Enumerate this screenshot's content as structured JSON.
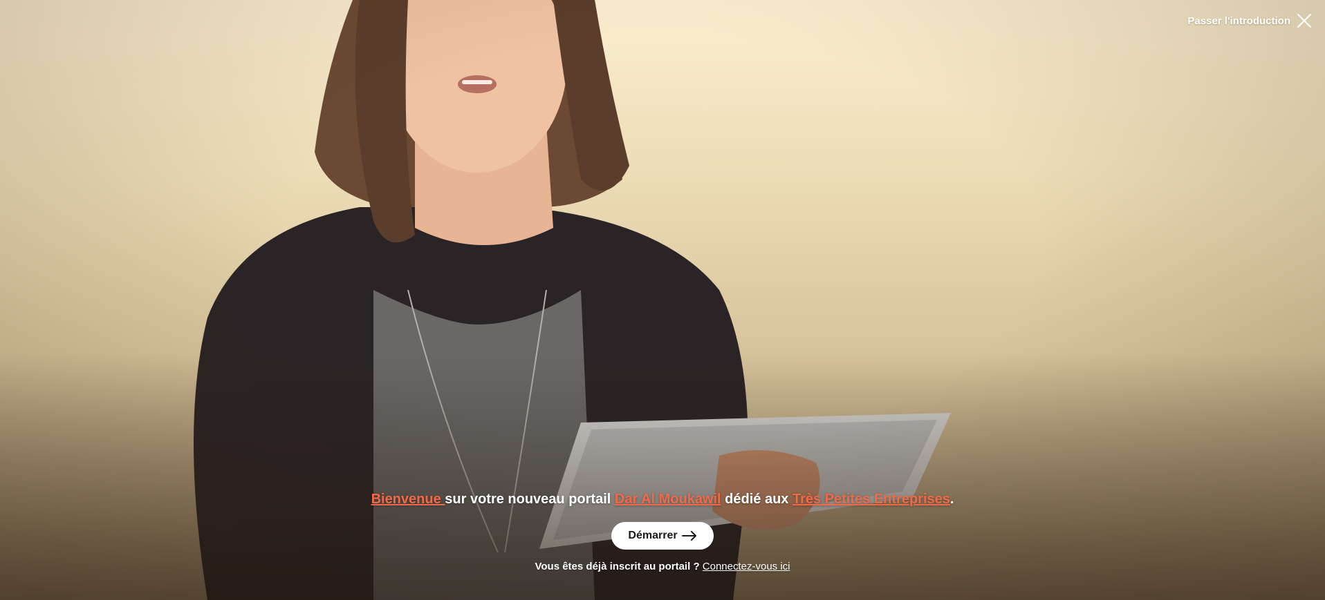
{
  "header": {
    "skip_label": "Passer l'introduction",
    "close_icon": "close-icon"
  },
  "hero": {
    "media": "video-background",
    "headline": {
      "part1_link": "Bienvenue ",
      "part2": "sur votre nouveau portail ",
      "part3_link": "Dar Al Moukawil",
      "part4": " dédié aux ",
      "part5_link": "Très Petites Entreprises",
      "part6": "."
    },
    "start_button_label": "Démarrer",
    "start_button_icon": "arrow-right-icon",
    "login_prompt": "Vous êtes déjà inscrit au portail ? ",
    "login_link": "Connectez-vous ici"
  },
  "colors": {
    "accent": "#f06a47",
    "text_light": "#ffffff",
    "button_bg": "#ffffff",
    "button_text": "#1a1a1a"
  }
}
